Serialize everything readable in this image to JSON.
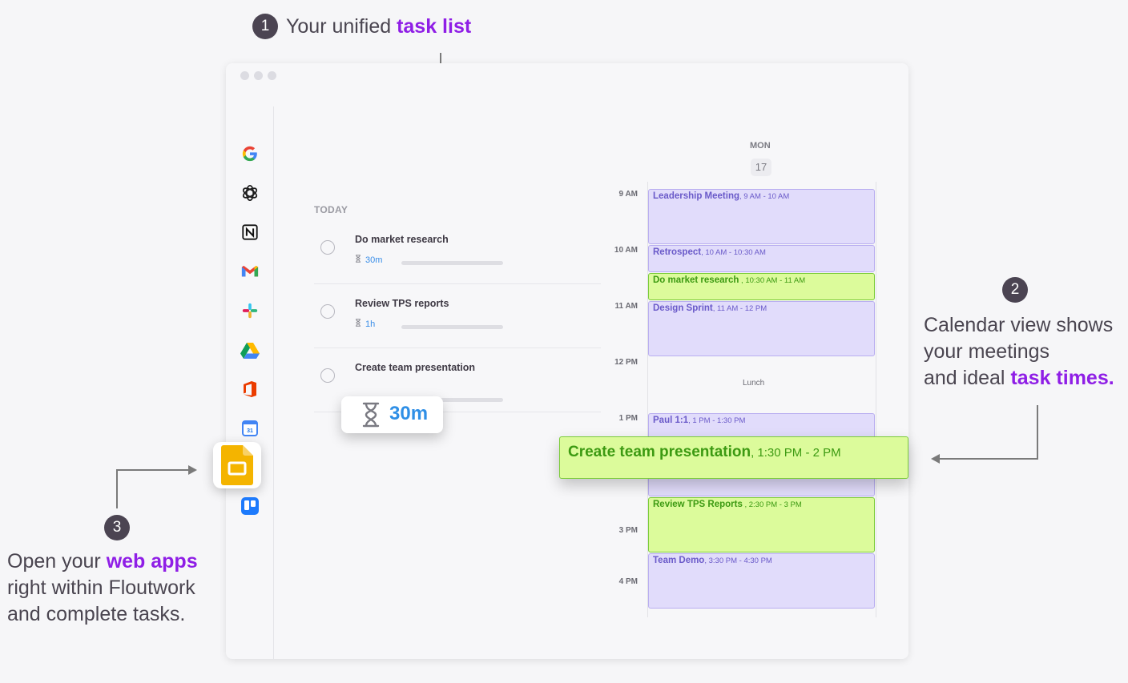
{
  "callouts": [
    {
      "number": "1",
      "text": "Your unified ",
      "highlight": "task list"
    },
    {
      "number": "2",
      "line1": "Calendar view shows",
      "line2": "your meetings",
      "line3_prefix": "and ideal ",
      "highlight": "task times."
    },
    {
      "number": "3",
      "line1_prefix": "Open your ",
      "highlight": "web apps",
      "line2": "right within Floutwork",
      "line3": "and complete tasks."
    }
  ],
  "sidebar_apps": [
    "google-icon",
    "chatgpt-icon",
    "notion-icon",
    "gmail-icon",
    "slack-icon",
    "google-drive-icon",
    "office-icon",
    "google-calendar-icon",
    "google-slides-icon",
    "trello-icon"
  ],
  "calendar_icon_text": "31",
  "task_list": {
    "section_label": "TODAY",
    "tasks": [
      {
        "title": "Do market research",
        "duration": "30m"
      },
      {
        "title": "Review TPS reports",
        "duration": "1h"
      },
      {
        "title": "Create team presentation",
        "duration": ""
      }
    ],
    "floating_timer": "30m"
  },
  "calendar": {
    "day": "MON",
    "date": "17",
    "times": [
      "9 AM",
      "10 AM",
      "11 AM",
      "12 PM",
      "1 PM",
      "3 PM",
      "4 PM"
    ],
    "lunch_label": "Lunch",
    "events": [
      {
        "title": "Leadership Meeting",
        "time": ", 9 AM - 10 AM",
        "kind": "meeting"
      },
      {
        "title": "Retrospect",
        "time": ", 10 AM - 10:30 AM",
        "kind": "meeting"
      },
      {
        "title": "Do market research",
        "time": " , 10:30 AM - 11 AM",
        "kind": "task"
      },
      {
        "title": "Design Sprint",
        "time": ", 11 AM - 12 PM",
        "kind": "meeting"
      },
      {
        "title": "Paul 1:1",
        "time": ", 1 PM - 1:30 PM",
        "kind": "meeting"
      },
      {
        "title": "Review TPS Reports",
        "time": " , 2:30 PM - 3 PM",
        "kind": "task"
      },
      {
        "title": "Team Demo",
        "time": ", 3:30 PM - 4:30 PM",
        "kind": "meeting"
      }
    ],
    "dragged_event": {
      "title": "Create team presentation",
      "time": ", 1:30 PM - 2 PM"
    }
  },
  "colors": {
    "accent": "#8f1ee6",
    "meeting": "#e1dcfb",
    "task": "#dcfb9b",
    "timer": "#2f8fe6"
  }
}
